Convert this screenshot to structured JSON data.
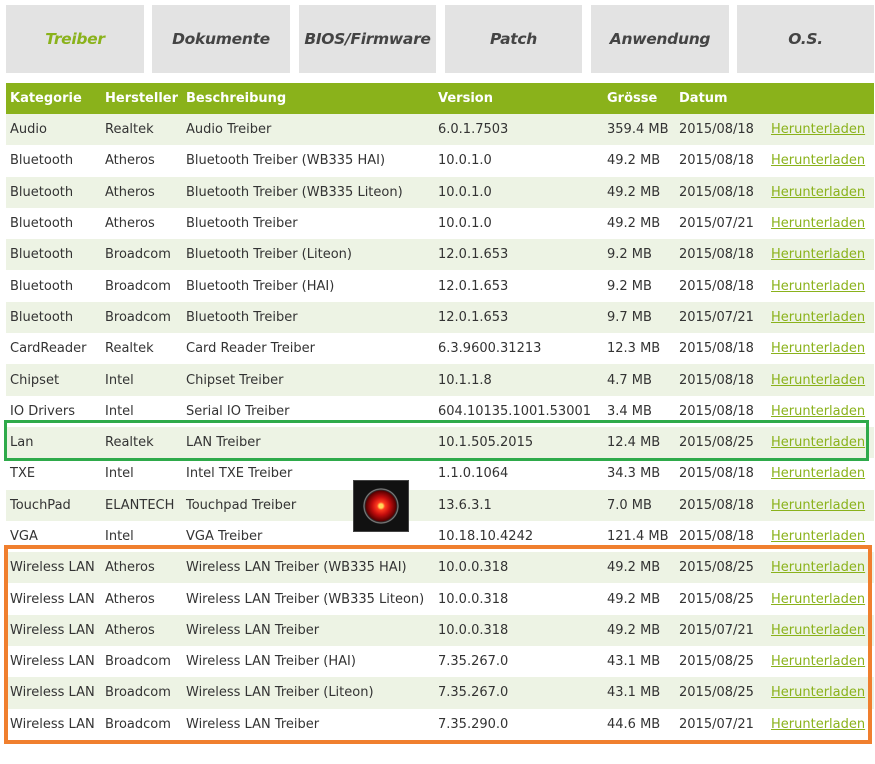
{
  "tabs": [
    {
      "label": "Treiber",
      "active": true
    },
    {
      "label": "Dokumente",
      "active": false
    },
    {
      "label": "BIOS/Firmware",
      "active": false
    },
    {
      "label": "Patch",
      "active": false
    },
    {
      "label": "Anwendung",
      "active": false
    },
    {
      "label": "O.S.",
      "active": false
    }
  ],
  "columns": [
    "Kategorie",
    "Hersteller",
    "Beschreibung",
    "Version",
    "Grösse",
    "Datum"
  ],
  "rows": [
    {
      "category": "Audio",
      "vendor": "Realtek",
      "description": "Audio Treiber",
      "version": "6.0.1.7503",
      "size": "359.4 MB",
      "date": "2015/08/18",
      "link": "Herunterladen"
    },
    {
      "category": "Bluetooth",
      "vendor": "Atheros",
      "description": "Bluetooth Treiber (WB335 HAI)",
      "version": "10.0.1.0",
      "size": "49.2 MB",
      "date": "2015/08/18",
      "link": "Herunterladen"
    },
    {
      "category": "Bluetooth",
      "vendor": "Atheros",
      "description": "Bluetooth Treiber (WB335 Liteon)",
      "version": "10.0.1.0",
      "size": "49.2 MB",
      "date": "2015/08/18",
      "link": "Herunterladen"
    },
    {
      "category": "Bluetooth",
      "vendor": "Atheros",
      "description": "Bluetooth Treiber",
      "version": "10.0.1.0",
      "size": "49.2 MB",
      "date": "2015/07/21",
      "link": "Herunterladen"
    },
    {
      "category": "Bluetooth",
      "vendor": "Broadcom",
      "description": "Bluetooth Treiber (Liteon)",
      "version": "12.0.1.653",
      "size": "9.2 MB",
      "date": "2015/08/18",
      "link": "Herunterladen"
    },
    {
      "category": "Bluetooth",
      "vendor": "Broadcom",
      "description": "Bluetooth Treiber (HAI)",
      "version": "12.0.1.653",
      "size": "9.2 MB",
      "date": "2015/08/18",
      "link": "Herunterladen"
    },
    {
      "category": "Bluetooth",
      "vendor": "Broadcom",
      "description": "Bluetooth Treiber",
      "version": "12.0.1.653",
      "size": "9.7 MB",
      "date": "2015/07/21",
      "link": "Herunterladen"
    },
    {
      "category": "CardReader",
      "vendor": "Realtek",
      "description": "Card Reader Treiber",
      "version": "6.3.9600.31213",
      "size": "12.3 MB",
      "date": "2015/08/18",
      "link": "Herunterladen"
    },
    {
      "category": "Chipset",
      "vendor": "Intel",
      "description": "Chipset Treiber",
      "version": "10.1.1.8",
      "size": "4.7 MB",
      "date": "2015/08/18",
      "link": "Herunterladen"
    },
    {
      "category": "IO Drivers",
      "vendor": "Intel",
      "description": "Serial IO Treiber",
      "version": "604.10135.1001.53001",
      "size": "3.4 MB",
      "date": "2015/08/18",
      "link": "Herunterladen"
    },
    {
      "category": "Lan",
      "vendor": "Realtek",
      "description": "LAN Treiber",
      "version": "10.1.505.2015",
      "size": "12.4 MB",
      "date": "2015/08/25",
      "link": "Herunterladen"
    },
    {
      "category": "TXE",
      "vendor": "Intel",
      "description": "Intel TXE Treiber",
      "version": "1.1.0.1064",
      "size": "34.3 MB",
      "date": "2015/08/18",
      "link": "Herunterladen"
    },
    {
      "category": "TouchPad",
      "vendor": "ELANTECH",
      "description": "Touchpad Treiber",
      "version": "13.6.3.1",
      "size": "7.0 MB",
      "date": "2015/08/18",
      "link": "Herunterladen"
    },
    {
      "category": "VGA",
      "vendor": "Intel",
      "description": "VGA Treiber",
      "version": "10.18.10.4242",
      "size": "121.4 MB",
      "date": "2015/08/18",
      "link": "Herunterladen"
    },
    {
      "category": "Wireless LAN",
      "vendor": "Atheros",
      "description": "Wireless LAN Treiber (WB335 HAI)",
      "version": "10.0.0.318",
      "size": "49.2 MB",
      "date": "2015/08/25",
      "link": "Herunterladen"
    },
    {
      "category": "Wireless LAN",
      "vendor": "Atheros",
      "description": "Wireless LAN Treiber (WB335 Liteon)",
      "version": "10.0.0.318",
      "size": "49.2 MB",
      "date": "2015/08/25",
      "link": "Herunterladen"
    },
    {
      "category": "Wireless LAN",
      "vendor": "Atheros",
      "description": "Wireless LAN Treiber",
      "version": "10.0.0.318",
      "size": "49.2 MB",
      "date": "2015/07/21",
      "link": "Herunterladen"
    },
    {
      "category": "Wireless LAN",
      "vendor": "Broadcom",
      "description": "Wireless LAN Treiber (HAI)",
      "version": "7.35.267.0",
      "size": "43.1 MB",
      "date": "2015/08/25",
      "link": "Herunterladen"
    },
    {
      "category": "Wireless LAN",
      "vendor": "Broadcom",
      "description": "Wireless LAN Treiber (Liteon)",
      "version": "7.35.267.0",
      "size": "43.1 MB",
      "date": "2015/08/25",
      "link": "Herunterladen"
    },
    {
      "category": "Wireless LAN",
      "vendor": "Broadcom",
      "description": "Wireless LAN Treiber",
      "version": "7.35.290.0",
      "size": "44.6 MB",
      "date": "2015/07/21",
      "link": "Herunterladen"
    }
  ],
  "colors": {
    "accent": "#8ab21b",
    "row_alt": "#edf3e4",
    "highlight_lan": "#2eaa4a",
    "highlight_wlan": "#f07f2e"
  },
  "overlay_icon": "hal-9000-eye-icon"
}
